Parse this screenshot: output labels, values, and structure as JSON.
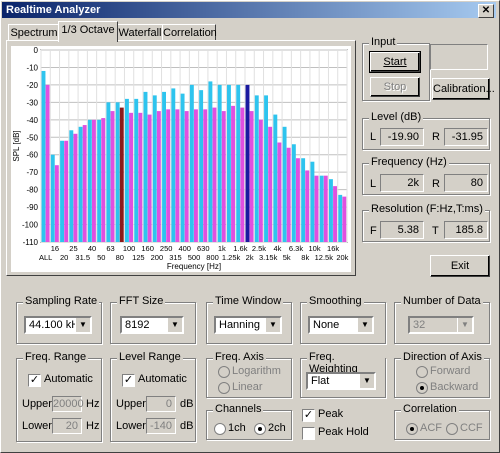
{
  "window": {
    "title": "Realtime Analyzer"
  },
  "tabs": [
    {
      "label": "Spectrum"
    },
    {
      "label": "1/3 Octave"
    },
    {
      "label": "Waterfall"
    },
    {
      "label": "Correlation"
    }
  ],
  "controls": {
    "input_label": "Input",
    "start": "Start",
    "stop": "Stop",
    "calibration": "Calibration...",
    "exit": "Exit"
  },
  "level": {
    "label": "Level (dB)",
    "l_label": "L",
    "l_value": "-19.90",
    "r_label": "R",
    "r_value": "-31.95"
  },
  "frequency": {
    "label": "Frequency (Hz)",
    "l_label": "L",
    "l_value": "2k",
    "r_label": "R",
    "r_value": "80"
  },
  "resolution": {
    "label": "Resolution (F:Hz,T:ms)",
    "f_label": "F",
    "f_value": "5.38",
    "t_label": "T",
    "t_value": "185.8"
  },
  "settings": {
    "sampling_rate": {
      "label": "Sampling Rate",
      "value": "44.100 kHz"
    },
    "fft_size": {
      "label": "FFT Size",
      "value": "8192"
    },
    "time_window": {
      "label": "Time Window",
      "value": "Hanning"
    },
    "smoothing": {
      "label": "Smoothing",
      "value": "None"
    },
    "number_of_data": {
      "label": "Number of Data",
      "value": "32"
    },
    "freq_range": {
      "label": "Freq. Range",
      "automatic": "Automatic",
      "upper_label": "Upper",
      "upper_value": "20000",
      "upper_unit": "Hz",
      "lower_label": "Lower",
      "lower_value": "20",
      "lower_unit": "Hz"
    },
    "level_range": {
      "label": "Level Range",
      "automatic": "Automatic",
      "upper_label": "Upper",
      "upper_value": "0",
      "upper_unit": "dB",
      "lower_label": "Lower",
      "lower_value": "-140",
      "lower_unit": "dB"
    },
    "freq_axis": {
      "label": "Freq. Axis",
      "opt1": "Logarithm",
      "opt2": "Linear"
    },
    "freq_weighting": {
      "label": "Freq. Weighting",
      "value": "Flat"
    },
    "direction": {
      "label": "Direction of Axis",
      "opt1": "Forward",
      "opt2": "Backward"
    },
    "channels": {
      "label": "Channels",
      "opt1": "1ch",
      "opt2": "2ch"
    },
    "peak": "Peak",
    "peak_hold": "Peak Hold",
    "correlation": {
      "label": "Correlation",
      "opt1": "ACF",
      "opt2": "CCF"
    }
  },
  "chart_data": {
    "type": "bar",
    "ylabel": "SPL [dB]",
    "xlabel": "Frequency [Hz]",
    "ylim": [
      -110,
      0
    ],
    "yticks": [
      0,
      -10,
      -20,
      -30,
      -40,
      -50,
      -60,
      -70,
      -80,
      -90,
      -100,
      -110
    ],
    "xticks_top": [
      "16",
      "25",
      "40",
      "63",
      "100",
      "160",
      "250",
      "400",
      "630",
      "1k",
      "1.6k",
      "2.5k",
      "4k",
      "6.3k",
      "10k",
      "16k"
    ],
    "xticks_bottom": [
      "ALL",
      "20",
      "31.5",
      "50",
      "80",
      "125",
      "200",
      "315",
      "500",
      "800",
      "1.25k",
      "2k",
      "3.15k",
      "5k",
      "8k",
      "12.5k",
      "20k"
    ],
    "categories": [
      "ALL",
      "16",
      "20",
      "25",
      "31.5",
      "40",
      "50",
      "63",
      "80",
      "100",
      "125",
      "160",
      "200",
      "250",
      "315",
      "400",
      "500",
      "630",
      "800",
      "1k",
      "1.25k",
      "1.6k",
      "2k",
      "2.5k",
      "3.15k",
      "4k",
      "5k",
      "6.3k",
      "8k",
      "10k",
      "12.5k",
      "16k",
      "20k"
    ],
    "series": [
      {
        "name": "L",
        "color": "#2ec4ee",
        "values": [
          -12,
          -60,
          -52,
          -46,
          -44,
          -40,
          -40,
          -30,
          -30,
          -28,
          -28,
          -24,
          -26,
          -24,
          -22,
          -25,
          -20,
          -23,
          -18,
          -20,
          -20,
          -20,
          -20,
          -26,
          -26,
          -37,
          -44,
          -54,
          -62,
          -64,
          -72,
          -74,
          -83
        ]
      },
      {
        "name": "R",
        "color": "#e050e0",
        "values": [
          -20,
          -66,
          -52,
          -48,
          -43,
          -40,
          -39,
          -35,
          -33,
          -36,
          -36,
          -37,
          -35,
          -34,
          -34,
          -35,
          -34,
          -34,
          -33,
          -35,
          -32,
          -33,
          -35,
          -40,
          -44,
          -53,
          -56,
          -62,
          -69,
          -72,
          -72,
          -78,
          -84
        ]
      }
    ],
    "highlight": [
      {
        "index": 8,
        "series": "R",
        "color": "#8b1a1a",
        "value": -32
      },
      {
        "index": 22,
        "series": "L",
        "color": "#1a1aa0",
        "value": -20
      }
    ]
  }
}
